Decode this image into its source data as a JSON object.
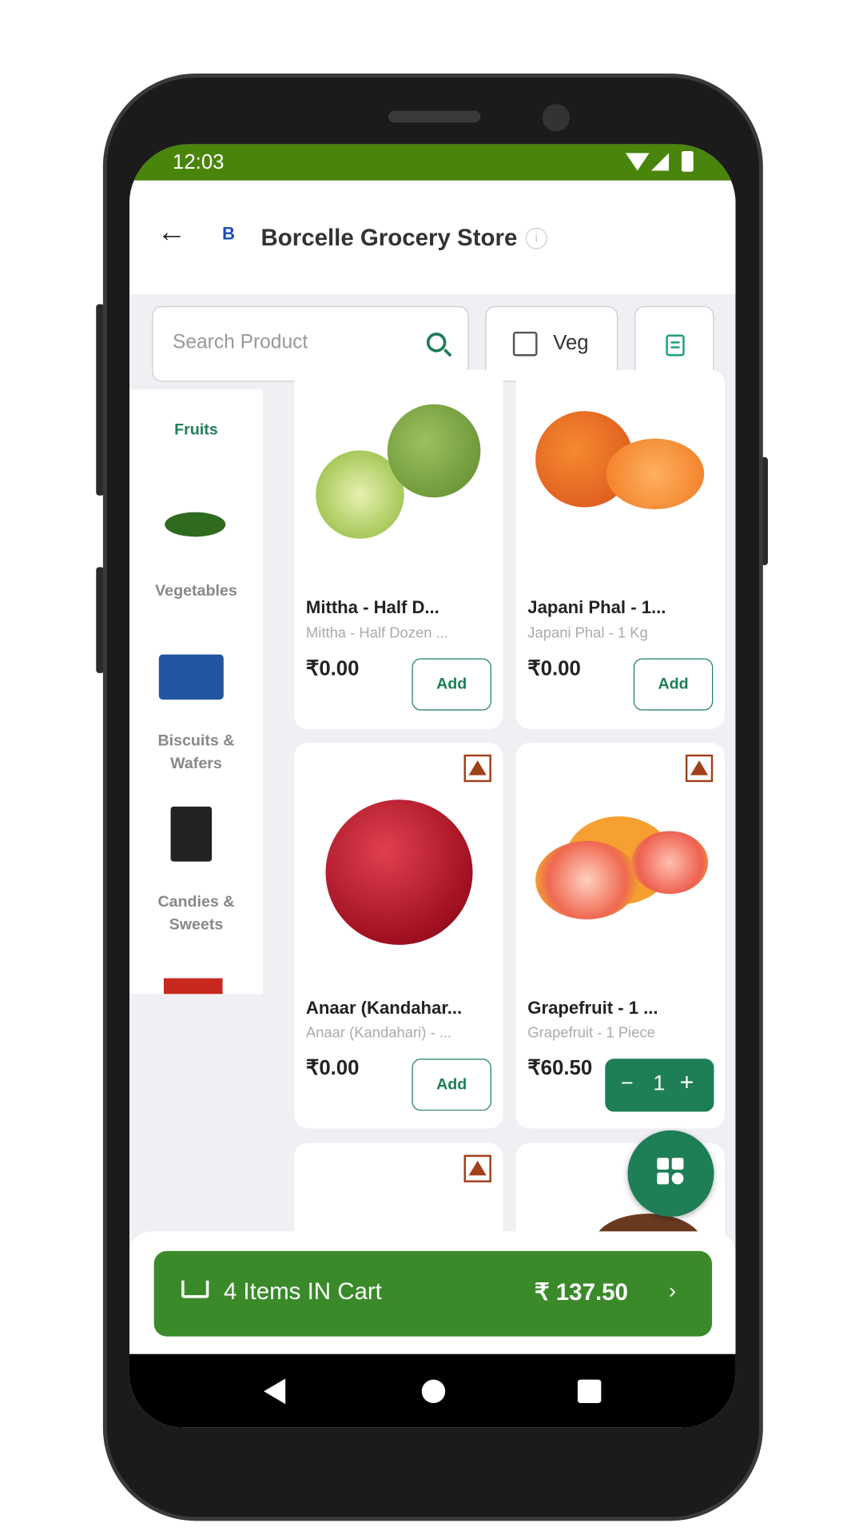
{
  "status_bar": {
    "time": "12:03"
  },
  "header": {
    "title": "Borcelle Grocery Store",
    "logo_text": "B"
  },
  "search": {
    "placeholder": "Search Product"
  },
  "veg_filter": {
    "label": "Veg",
    "checked": false
  },
  "categories": [
    {
      "label": "Fruits",
      "selected": true
    },
    {
      "label": "Vegetables"
    },
    {
      "label": "Biscuits & Wafers"
    },
    {
      "label": "Candies & Sweets"
    }
  ],
  "products": [
    {
      "name": "Mittha - Half D...",
      "subtitle": "Mittha - Half Dozen ...",
      "price": "₹0.00",
      "action": "Add"
    },
    {
      "name": "Japani Phal - 1...",
      "subtitle": "Japani Phal - 1 Kg",
      "price": "₹0.00",
      "action": "Add"
    },
    {
      "name": "Anaar (Kandahar...",
      "subtitle": "Anaar (Kandahari) - ...",
      "price": "₹0.00",
      "action": "Add",
      "non_veg_marker": true
    },
    {
      "name": "Grapefruit - 1 ...",
      "subtitle": "Grapefruit - 1 Piece",
      "price": "₹60.50",
      "quantity": "1",
      "non_veg_marker": true
    }
  ],
  "cart": {
    "label": "4 Items IN Cart",
    "total": "₹ 137.50"
  },
  "colors": {
    "status_bar": "#4a850b",
    "accent": "#1e7e56",
    "cart_button": "#3a8a2a",
    "non_veg": "#a0401a"
  }
}
